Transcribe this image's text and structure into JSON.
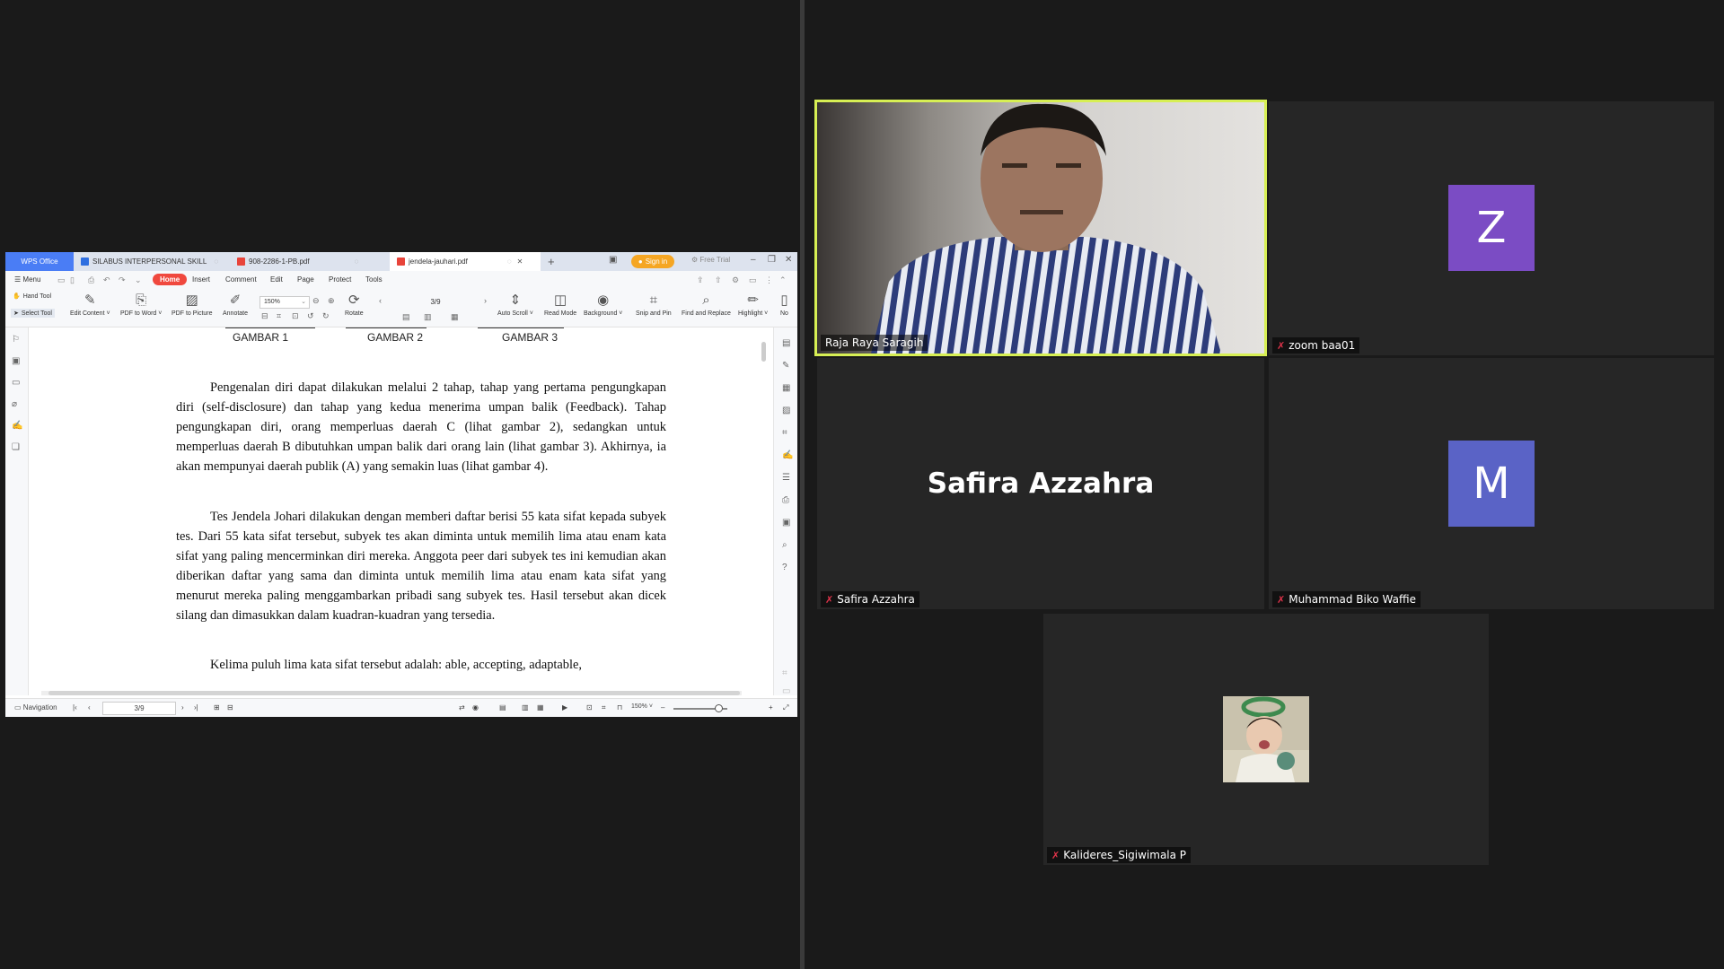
{
  "wps": {
    "tabs": {
      "app": "WPS Office",
      "doc1": "SILABUS INTERPERSONAL SKILL",
      "doc2": "908-2286-1-PB.pdf",
      "doc3": "jendela-jauhari.pdf",
      "new": "+"
    },
    "sign_in": "Sign in",
    "free_trial": "Free Trial",
    "menu": {
      "menu": "Menu",
      "home": "Home",
      "insert": "Insert",
      "comment": "Comment",
      "edit": "Edit",
      "page": "Page",
      "protect": "Protect",
      "tools": "Tools"
    },
    "toolbar": {
      "hand_tool": "Hand Tool",
      "select_tool": "Select Tool",
      "edit_content": "Edit Content ˅",
      "pdf_to_word": "PDF to Word ˅",
      "pdf_to_picture": "PDF to Picture",
      "annotate": "Annotate",
      "zoom": "150%",
      "rotate": "Rotate",
      "page": "3/9",
      "auto_scroll": "Auto Scroll ˅",
      "read_mode": "Read Mode",
      "background": "Background ˅",
      "snip_and_pin": "Snip and Pin",
      "find_and_replace": "Find and Replace",
      "highlight": "Highlight ˅",
      "more": "No"
    },
    "document": {
      "figure_labels": [
        "GAMBAR 1",
        "GAMBAR 2",
        "GAMBAR 3"
      ],
      "paragraphs": [
        "Pengenalan diri dapat dilakukan melalui 2 tahap, tahap yang pertama pengungkapan diri (self-disclosure) dan tahap yang kedua menerima umpan balik (Feedback). Tahap pengungkapan diri, orang memperluas daerah C (lihat gambar 2), sedangkan untuk memperluas daerah B dibutuhkan umpan balik dari orang lain (lihat gambar 3). Akhirnya, ia akan mempunyai daerah publik (A) yang semakin luas (lihat gambar 4).",
        "Tes Jendela Johari dilakukan dengan memberi daftar berisi 55 kata sifat kepada subyek tes. Dari 55 kata sifat tersebut, subyek tes akan diminta untuk memilih lima atau enam kata sifat yang paling mencerminkan diri mereka. Anggota peer dari subyek tes ini kemudian akan diberikan daftar yang sama dan diminta untuk memilih lima atau enam kata sifat yang menurut mereka paling menggambarkan pribadi sang subyek tes. Hasil tersebut akan dicek silang dan dimasukkan dalam kuadran-kuadran yang tersedia.",
        "Kelima puluh lima kata sifat tersebut adalah: able, accepting, adaptable,"
      ]
    },
    "status": {
      "navigation": "Navigation",
      "page": "3/9",
      "zoom": "150%"
    }
  },
  "participants": [
    {
      "name": "Raja Raya Saragih",
      "video": true,
      "active_speaker": true
    },
    {
      "name": "zoom baa01",
      "initial": "Z",
      "avatar_color": "#7b4cc4",
      "muted": true
    },
    {
      "name": "Safira Azzahra",
      "display_name": "Safira Azzahra",
      "muted": true
    },
    {
      "name": "Muhammad Biko Waffie",
      "initial": "M",
      "avatar_color": "#5a63c6",
      "muted": true
    },
    {
      "name": "Kalideres_Sigiwimala P",
      "muted": true,
      "photo_avatar": true
    }
  ]
}
